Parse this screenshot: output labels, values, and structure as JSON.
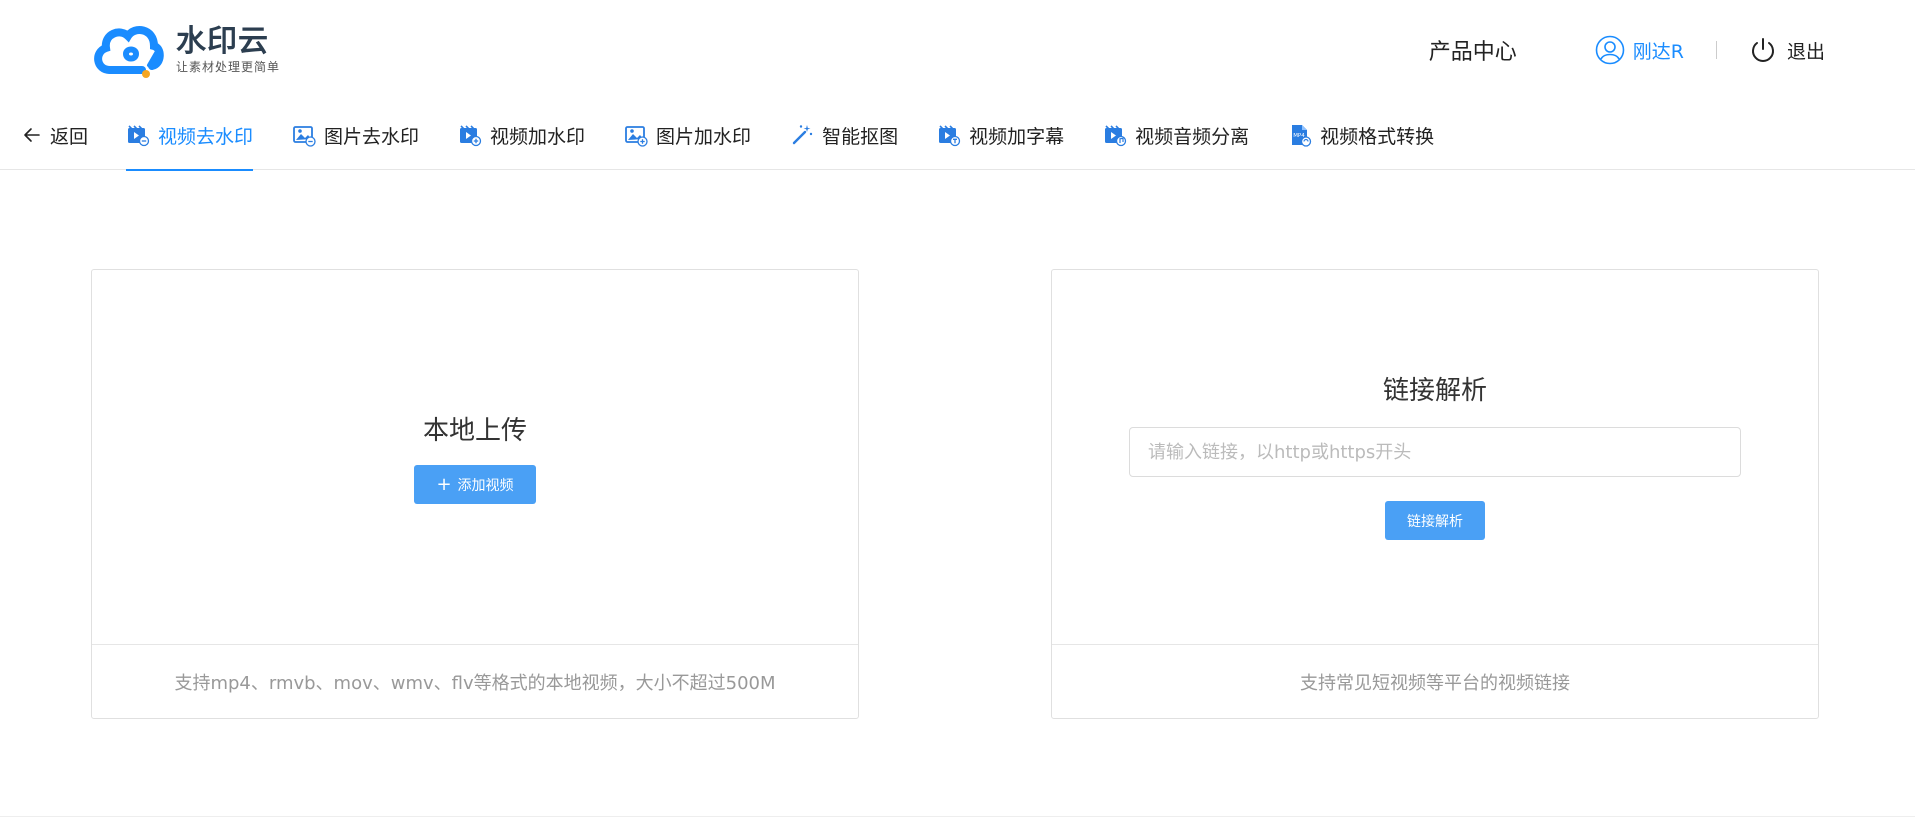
{
  "header": {
    "logo_title": "水印云",
    "logo_slogan": "让素材处理更简单",
    "product_center": "产品中心",
    "username": "刚达R",
    "logout": "退出"
  },
  "tabbar": {
    "back": "返回",
    "tabs": [
      {
        "label": "视频去水印",
        "icon": "video-remove-icon",
        "active": true
      },
      {
        "label": "图片去水印",
        "icon": "image-remove-icon",
        "active": false
      },
      {
        "label": "视频加水印",
        "icon": "video-add-icon",
        "active": false
      },
      {
        "label": "图片加水印",
        "icon": "image-add-icon",
        "active": false
      },
      {
        "label": "智能抠图",
        "icon": "magic-wand-icon",
        "active": false
      },
      {
        "label": "视频加字幕",
        "icon": "video-subtitle-icon",
        "active": false
      },
      {
        "label": "视频音频分离",
        "icon": "video-audio-split-icon",
        "active": false
      },
      {
        "label": "视频格式转换",
        "icon": "mp4-convert-icon",
        "active": false
      }
    ]
  },
  "upload_card": {
    "title": "本地上传",
    "button": "添加视频",
    "note": "支持mp4、rmvb、mov、wmv、flv等格式的本地视频，大小不超过500M"
  },
  "link_card": {
    "title": "链接解析",
    "placeholder": "请输入链接，以http或https开头",
    "value": "",
    "button": "链接解析",
    "note": "支持常见短视频等平台的视频链接"
  },
  "colors": {
    "accent": "#1a8cff",
    "button": "#4aa0f5",
    "logo_blue": "#1a8cff",
    "logo_orange": "#f5a623"
  }
}
